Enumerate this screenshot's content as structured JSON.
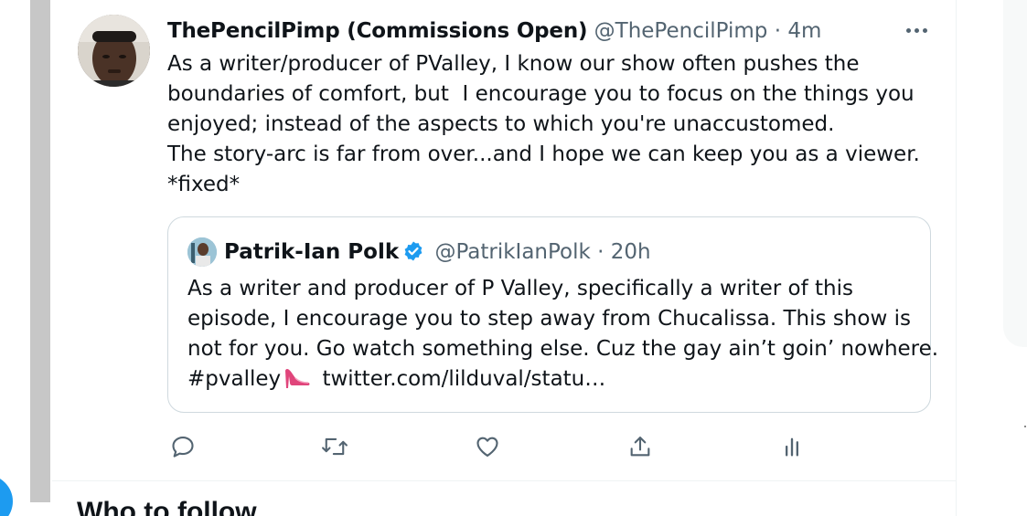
{
  "tweet": {
    "author": {
      "display_name": "ThePencilPimp (Commissions Open)",
      "handle": "@ThePencilPimp",
      "separator": "·",
      "time": "4m"
    },
    "text_lines": [
      "As a writer/producer of PValley, I know our show often pushes the",
      "boundaries of comfort, but  I encourage you to focus on the things you",
      "enjoyed; instead of the aspects to which you're unaccustomed.",
      "The story-arc is far from over...and I hope we can keep you as a viewer.",
      "*fixed*"
    ],
    "more_icon": "more-horizontal-icon",
    "quoted": {
      "display_name": "Patrik-Ian Polk",
      "verified_icon": "verified-badge-icon",
      "handle": "@PatrikIanPolk",
      "separator": "·",
      "time": "20h",
      "text_lines": [
        "As a writer and producer of P Valley, specifically a writer of this",
        "episode, I encourage you to step away from Chucalissa. This show is",
        "not for you. Go watch something else. Cuz the gay ain’t goin’ nowhere."
      ],
      "hashtag": "#pvalley",
      "emoji_icon": "high-heel-icon",
      "link": "twitter.com/lilduval/statu…"
    },
    "actions": [
      {
        "name": "reply-button",
        "icon": "reply-icon"
      },
      {
        "name": "retweet-button",
        "icon": "retweet-icon"
      },
      {
        "name": "like-button",
        "icon": "heart-icon"
      },
      {
        "name": "share-button",
        "icon": "share-icon"
      },
      {
        "name": "analytics-button",
        "icon": "analytics-icon"
      }
    ]
  },
  "who_to_follow": {
    "title": "Who to follow"
  },
  "colors": {
    "text_primary": "#0f1419",
    "text_secondary": "#536471",
    "border": "#cfd9de",
    "verified_blue": "#1d9bf0",
    "heel_pink": "#e0457b"
  }
}
